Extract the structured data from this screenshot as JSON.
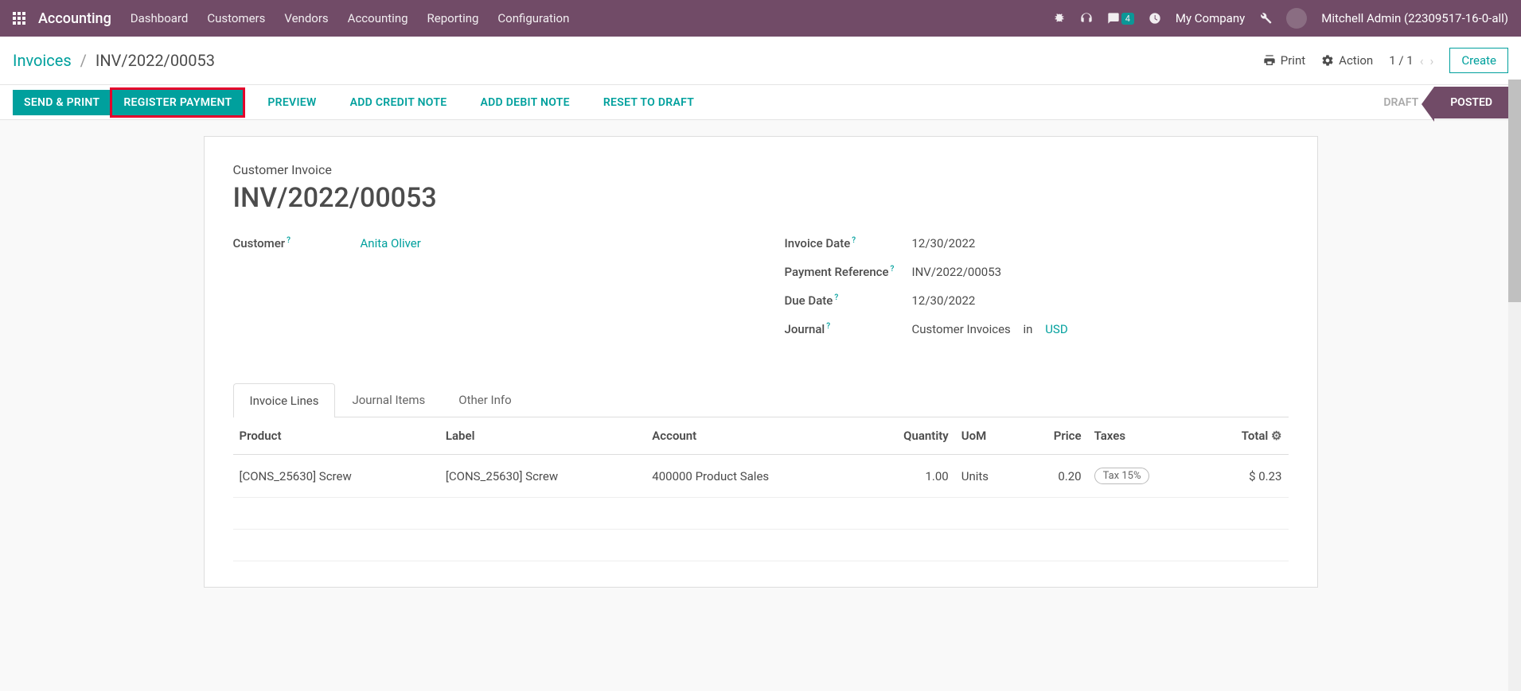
{
  "nav": {
    "brand": "Accounting",
    "menu": [
      "Dashboard",
      "Customers",
      "Vendors",
      "Accounting",
      "Reporting",
      "Configuration"
    ],
    "messages_count": "4",
    "company": "My Company",
    "user": "Mitchell Admin (22309517-16-0-all)"
  },
  "breadcrumb": {
    "parent": "Invoices",
    "current": "INV/2022/00053",
    "print": "Print",
    "action": "Action",
    "pager": "1 / 1",
    "create": "Create"
  },
  "actions": {
    "send_print": "SEND & PRINT",
    "register_payment": "REGISTER PAYMENT",
    "preview": "PREVIEW",
    "add_credit": "ADD CREDIT NOTE",
    "add_debit": "ADD DEBIT NOTE",
    "reset_draft": "RESET TO DRAFT"
  },
  "status": {
    "draft": "DRAFT",
    "posted": "POSTED"
  },
  "doc": {
    "type": "Customer Invoice",
    "title": "INV/2022/00053",
    "customer_label": "Customer",
    "customer": "Anita Oliver",
    "invoice_date_label": "Invoice Date",
    "invoice_date": "12/30/2022",
    "payment_ref_label": "Payment Reference",
    "payment_ref": "INV/2022/00053",
    "due_date_label": "Due Date",
    "due_date": "12/30/2022",
    "journal_label": "Journal",
    "journal": "Customer Invoices",
    "journal_in": "in",
    "currency": "USD"
  },
  "tabs": {
    "lines": "Invoice Lines",
    "journal": "Journal Items",
    "other": "Other Info"
  },
  "table": {
    "headers": {
      "product": "Product",
      "label": "Label",
      "account": "Account",
      "quantity": "Quantity",
      "uom": "UoM",
      "price": "Price",
      "taxes": "Taxes",
      "total": "Total"
    },
    "rows": [
      {
        "product": "[CONS_25630] Screw",
        "label": "[CONS_25630] Screw",
        "account": "400000 Product Sales",
        "quantity": "1.00",
        "uom": "Units",
        "price": "0.20",
        "taxes": "Tax 15%",
        "total": "$ 0.23"
      }
    ]
  }
}
